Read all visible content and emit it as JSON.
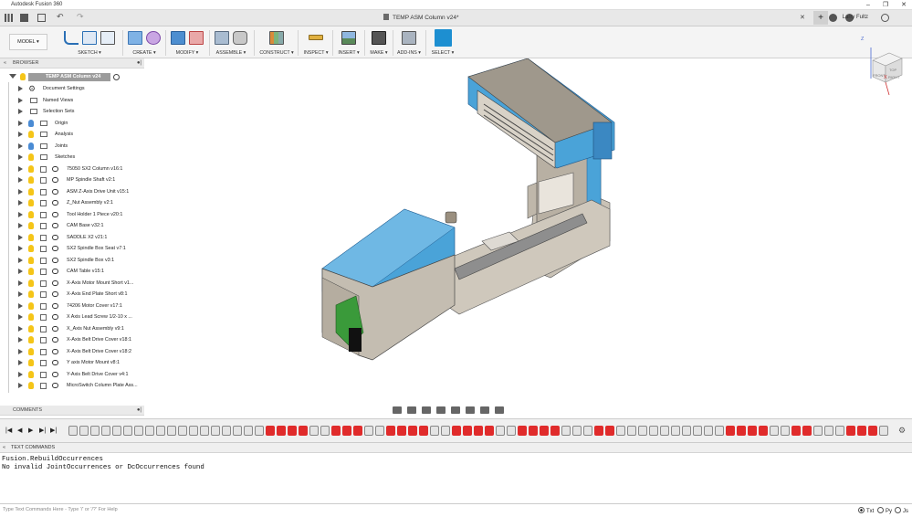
{
  "window": {
    "title": "Autodesk Fusion 360",
    "controls": [
      "–",
      "❐",
      "✕"
    ]
  },
  "tabbar": {
    "doc_title": "TEMP ASM Column v24*",
    "user": "Larry Fultz"
  },
  "toolbar": {
    "workspace": "MODEL",
    "groups": [
      {
        "label": "SKETCH ▾"
      },
      {
        "label": "CREATE ▾"
      },
      {
        "label": "MODIFY ▾"
      },
      {
        "label": "ASSEMBLE ▾"
      },
      {
        "label": "CONSTRUCT ▾"
      },
      {
        "label": "INSPECT ▾"
      },
      {
        "label": "INSERT ▾"
      },
      {
        "label": "MAKE ▾"
      },
      {
        "label": "ADD-INS ▾"
      },
      {
        "label": "SELECT ▾"
      }
    ]
  },
  "browser": {
    "header": "BROWSER",
    "root": "TEMP ASM Column v24",
    "items": [
      {
        "label": "Document Settings",
        "icon": "gear-icon"
      },
      {
        "label": "Named Views",
        "icon": "folder-icon"
      },
      {
        "label": "Selection Sets",
        "icon": "folder-icon"
      },
      {
        "label": "Origin",
        "icon": "folder-icon"
      },
      {
        "label": "Analysis",
        "icon": "folder-icon"
      },
      {
        "label": "Joints",
        "icon": "folder-icon"
      },
      {
        "label": "Sketches",
        "icon": "folder-icon"
      },
      {
        "label": "75050 SX2 Column v16:1",
        "icon": "component-icon"
      },
      {
        "label": "MP Spindle Shaft v2:1",
        "icon": "component-icon"
      },
      {
        "label": "ASM Z-Axis Drive Unit v15:1",
        "icon": "component-icon"
      },
      {
        "label": "Z_Nut Assembly v2:1",
        "icon": "component-icon"
      },
      {
        "label": "Tool Holder 1 Piece v20:1",
        "icon": "component-icon"
      },
      {
        "label": "CAM Base v32:1",
        "icon": "component-icon"
      },
      {
        "label": "SADDLE X2 v21:1",
        "icon": "component-icon"
      },
      {
        "label": "SX2 Spindle Box Seat v7:1",
        "icon": "component-icon"
      },
      {
        "label": "SX2 Spindle Box v3:1",
        "icon": "component-icon"
      },
      {
        "label": "CAM Table v15:1",
        "icon": "component-icon"
      },
      {
        "label": "X-Axis Motor Mount Short v1...",
        "icon": "component-icon"
      },
      {
        "label": "X-Axis End Plate Short v8:1",
        "icon": "component-icon"
      },
      {
        "label": "74206 Motor Cover v17:1",
        "icon": "component-icon"
      },
      {
        "label": "X Axis Lead Screw 1/2-10 x ...",
        "icon": "component-icon"
      },
      {
        "label": "X_Axis Nut Assembly v9:1",
        "icon": "component-icon"
      },
      {
        "label": "X-Axis Belt Drive Cover v18:1",
        "icon": "component-icon"
      },
      {
        "label": "X-Axis Belt Drive Cover v18:2",
        "icon": "component-icon"
      },
      {
        "label": "Y axis Motor Mount v8:1",
        "icon": "component-icon"
      },
      {
        "label": "Y-Axis Belt Drive Cover v4:1",
        "icon": "component-icon"
      },
      {
        "label": "MicroSwitch Column Plate Ass...",
        "icon": "component-icon"
      }
    ]
  },
  "comments": {
    "header": "COMMENTS"
  },
  "viewcube": {
    "faces": [
      "TOP",
      "FRONT",
      "RIGHT"
    ],
    "axes": [
      "Z",
      "X"
    ]
  },
  "text_commands": {
    "header": "TEXT COMMANDS",
    "output": "Fusion.RebuildOccurrences\nNo invalid JointOccurrences or DcOccurrences found",
    "placeholder": "Type Text Commands Here - Type '/' or '/?' For Help",
    "modes": [
      "Txt",
      "Py",
      "Js"
    ],
    "selected_mode": "Txt"
  },
  "colors": {
    "accent": "#1d8fd1",
    "part_blue": "#4aa3d8",
    "part_grey": "#b9b2a6",
    "part_green": "#3a9a3a",
    "feature_red": "#e02b2b",
    "feature_yellow": "#f0e030"
  }
}
